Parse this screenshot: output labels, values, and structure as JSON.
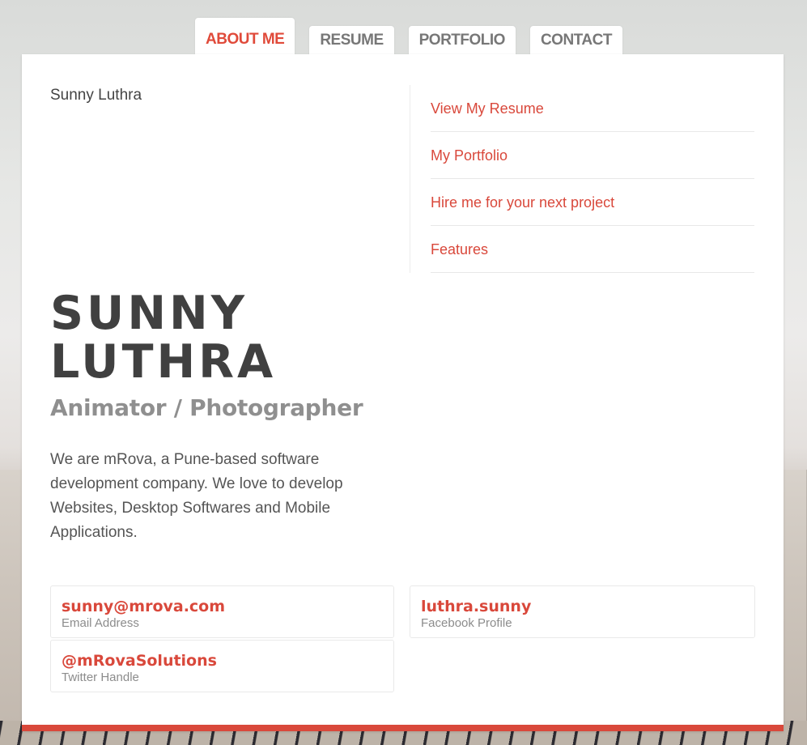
{
  "nav": {
    "tabs": [
      {
        "label": "ABOUT ME"
      },
      {
        "label": "RESUME"
      },
      {
        "label": "PORTFOLIO"
      },
      {
        "label": "CONTACT"
      }
    ],
    "active_index": 0
  },
  "profile": {
    "site_name": "Sunny Luthra",
    "name_line1": "SUNNY",
    "name_line2": "LUTHRA",
    "title": "Animator / Photographer",
    "intro": "We are mRova, a Pune-based software development company. We love to develop Websites, Desktop Softwares and Mobile Applications."
  },
  "menu": {
    "items": [
      {
        "label": "View My Resume"
      },
      {
        "label": "My Portfolio"
      },
      {
        "label": "Hire me for your next project"
      },
      {
        "label": "Features"
      }
    ]
  },
  "contacts": [
    {
      "value": "sunny@mrova.com",
      "label": "Email Address"
    },
    {
      "value": "luthra.sunny",
      "label": "Facebook Profile"
    },
    {
      "value": "@mRovaSolutions",
      "label": "Twitter Handle"
    }
  ],
  "colors": {
    "accent": "#d9483b",
    "heading": "#404040",
    "subtitle": "#8f8f8f",
    "text": "#555555"
  }
}
